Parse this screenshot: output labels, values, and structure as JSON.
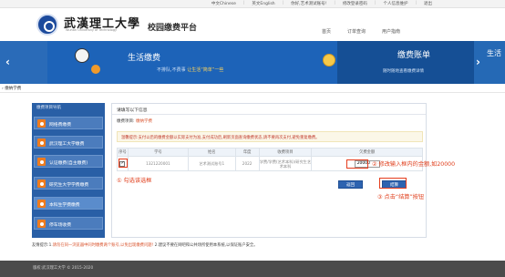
{
  "topbar": {
    "links": [
      "中文Chinese",
      "英文English",
      "你好,艺术测试账号!",
      "修改登录密码",
      "个人信息维护",
      "退出"
    ]
  },
  "header": {
    "school_name": "武漢理工大學",
    "school_en": "Wuhan University of Technology",
    "platform": "校园缴费平台",
    "nav": [
      "首页",
      "订单查询",
      "用户指南"
    ]
  },
  "banner": {
    "title": "生活缴费",
    "sub_left": "不排队,不费事",
    "sub_highlight": "让生活“简单”一些",
    "right_title": "缴费账单",
    "right_sub": "随时随地查看缴费详情",
    "edge_text": "生活",
    "colors": {
      "primary": "#1e5aa6",
      "highlight": "#ffd45a"
    }
  },
  "breadcrumb": "› 缴纳学费",
  "sidebar": {
    "header": "缴费项目导航",
    "items": [
      {
        "label": "网络费缴费",
        "icon": "network-icon"
      },
      {
        "label": "武汉理工大学缴费",
        "icon": "school-icon"
      },
      {
        "label": "认证缴费(自主缴费)",
        "icon": "auth-icon"
      },
      {
        "label": "研究生大学学费缴费",
        "icon": "graduate-icon"
      },
      {
        "label": "本科生学费缴费",
        "icon": "undergrad-icon",
        "active": true
      },
      {
        "label": "停车场收费",
        "icon": "parking-icon"
      }
    ]
  },
  "panel": {
    "title": "请填写以下信息",
    "item_label": "缴费项目:",
    "item_value": "缴纳学费",
    "warning": "温馨提示:支付以后的缴费金额以实际支付为准,支付成功后,刷新页面查询缴费状态,请不要再次支付,避免重复缴费。",
    "table": {
      "headers": [
        "序号",
        "学号",
        "姓名",
        "年度",
        "收费项目",
        "欠费金额"
      ],
      "rows": [
        {
          "student_id": "1321220001",
          "name": "艺术测试账号1",
          "year": "2022",
          "item": "学费/学费(艺术本科)/研究生艺术本科",
          "amount": "20000"
        }
      ]
    },
    "buttons": {
      "back": "返回",
      "settle": "结算"
    },
    "colors": {
      "button": "#2d63b0",
      "warning": "#c0392b"
    }
  },
  "annotations": {
    "step1": "① 勾选该选框",
    "step2": "② 修改输入框内的金额,如20000",
    "step3": "③ 点击“结算”按钮",
    "color": "#e0401e"
  },
  "footer_note": {
    "prefix": "友情提示:1.",
    "red_text": "请勿在同一浏览器中同时缴费两个账号,以免出现缴费问题!",
    "rest": " 2.建议不要在网吧和公共场所使用本系统,以保证账户安全。"
  },
  "footer": "版权:武汉理工大学 © 2015-2020"
}
